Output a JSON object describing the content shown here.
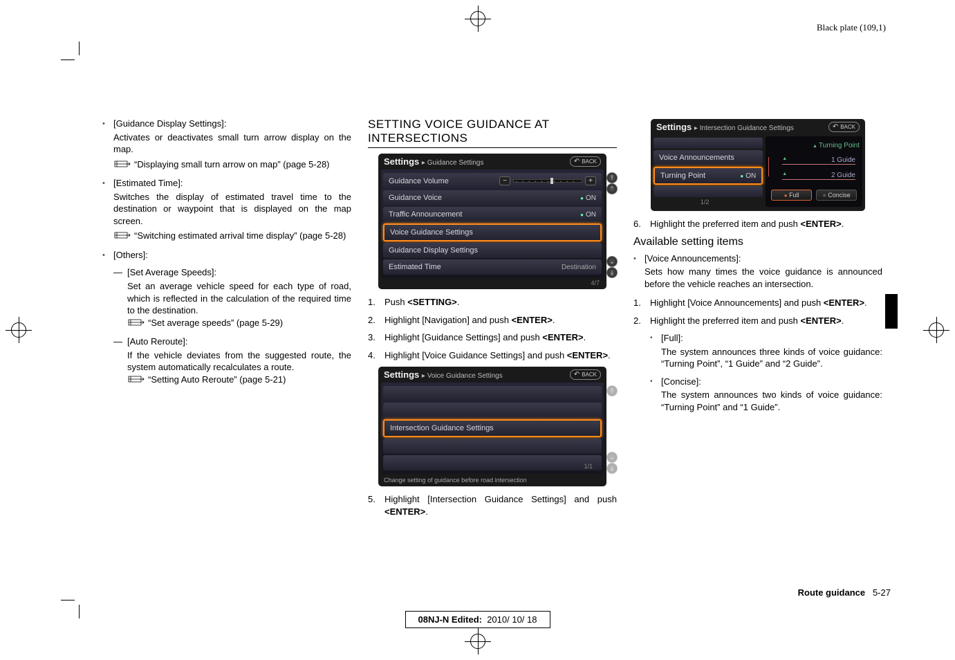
{
  "plate_label": "Black plate (109,1)",
  "col1": {
    "i1_title": "[Guidance Display Settings]:",
    "i1_body": "Activates or deactivates small turn arrow display on the map.",
    "i1_ref": "“Displaying small turn arrow on map” (page 5-28)",
    "i2_title": "[Estimated Time]:",
    "i2_body": "Switches the display of estimated travel time to the destination or waypoint that is displayed on the map screen.",
    "i2_ref": "“Switching estimated arrival time display” (page 5-28)",
    "i3_title": "[Others]:",
    "s1_title": "[Set Average Speeds]:",
    "s1_body": "Set an average vehicle speed for each type of road, which is reflected in the calculation of the required time to the destination.",
    "s1_ref": "“Set average speeds” (page 5-29)",
    "s2_title": "[Auto Reroute]:",
    "s2_body": "If the vehicle deviates from the suggested route, the system automatically recalculates a route.",
    "s2_ref": "“Setting Auto Reroute” (page 5-21)"
  },
  "col2": {
    "heading": "SETTING VOICE GUIDANCE AT INTERSECTIONS",
    "panel1": {
      "title_bold": "Settings",
      "title_crumb": "Guidance Settings",
      "back": "BACK",
      "r1": "Guidance Volume",
      "r1_minus": "−",
      "r1_plus": "+",
      "r2": "Guidance Voice",
      "r2_state": "ON",
      "r3": "Traffic Announcement",
      "r3_state": "ON",
      "r4": "Voice Guidance Settings",
      "r5": "Guidance Display Settings",
      "r6": "Estimated Time",
      "r6_val": "Destination",
      "pagecount": "4/7"
    },
    "step1": "Push <SETTING>.",
    "step2": "Highlight [Navigation] and push <ENTER>.",
    "step3": "Highlight [Guidance Settings] and push <ENTER>.",
    "step4": "Highlight [Voice Guidance Settings] and push <ENTER>.",
    "panel2": {
      "title_bold": "Settings",
      "title_crumb": "Voice Guidance Settings",
      "back": "BACK",
      "r1": "Intersection Guidance Settings",
      "pagecount": "1/1",
      "hint": "Change setting of guidance before road intersection"
    },
    "step5": "Highlight [Intersection Guidance Settings] and push <ENTER>."
  },
  "col3": {
    "panel3": {
      "title_bold": "Settings",
      "title_crumb": "Intersection Guidance Settings",
      "back": "BACK",
      "l1": "Voice Announcements",
      "l2": "Turning Point",
      "l2_state": "ON",
      "pagecount": "1/2",
      "rp_tp": "Turning Point",
      "rp_g1": "1 Guide",
      "rp_g2": "2 Guide",
      "rp_full": "Full",
      "rp_concise": "Concise"
    },
    "step6": "Highlight the preferred item and push <ENTER>.",
    "subhead": "Available setting items",
    "b1_title": "[Voice Announcements]:",
    "b1_body": "Sets how many times the voice guidance is announced before the vehicle reaches an intersection.",
    "n1": "Highlight [Voice Announcements] and push <ENTER>.",
    "n2": "Highlight the preferred item and push <ENTER>.",
    "f_title": "[Full]:",
    "f_body": "The system announces three kinds of voice guidance: “Turning Point”, “1 Guide” and “2 Guide”.",
    "c_title": "[Concise]:",
    "c_body": "The system announces two kinds of voice guidance: “Turning Point” and “1 Guide”."
  },
  "footer": {
    "route_bold": "Route guidance",
    "route_page": "5-27",
    "foot_label": "08NJ-N Edited:",
    "foot_date": "2010/ 10/ 18"
  }
}
